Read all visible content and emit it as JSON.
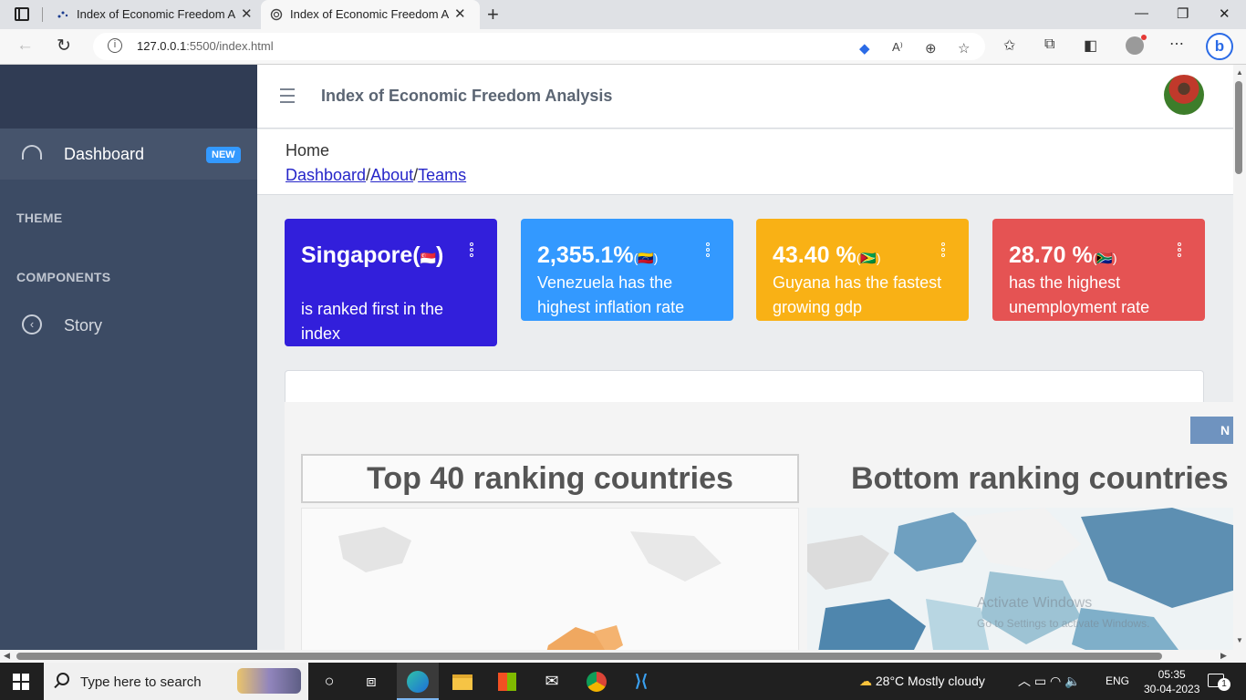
{
  "browser": {
    "tabs": [
      {
        "title": "Index of Economic Freedom Ana",
        "active": false
      },
      {
        "title": "Index of Economic Freedom Ana",
        "active": true
      }
    ],
    "url_host": "127.0.0.1",
    "url_path": ":5500/index.html"
  },
  "sidebar": {
    "items": [
      {
        "label": "Dashboard",
        "badge": "NEW",
        "icon": "speedometer-icon"
      },
      {
        "label": "Story",
        "icon": "chevron-circle-icon"
      }
    ],
    "sections": [
      "THEME",
      "COMPONENTS"
    ]
  },
  "header": {
    "title": "Index of Economic Freedom Analysis"
  },
  "breadcrumb": {
    "home": "Home",
    "links": [
      "Dashboard",
      "About",
      "Teams"
    ],
    "separator": "/"
  },
  "cards": [
    {
      "value": "Singapore(",
      "flag": "🇸🇬",
      "suffix": ")",
      "desc": "is ranked first in the index",
      "color": "#321fdb"
    },
    {
      "value": "2,355.1%",
      "flag": "(🇻🇪)",
      "suffix": "",
      "desc": "Venezuela has the highest inflation rate",
      "color": "#3399ff"
    },
    {
      "value": "43.40 %",
      "flag": "(🇬🇾)",
      "suffix": "",
      "desc": "Guyana has the fastest growing gdp",
      "color": "#f9b115"
    },
    {
      "value": "28.70 %",
      "flag": "(🇿🇦)",
      "suffix": "",
      "desc": "has the highest unemployment rate",
      "color": "#e55353"
    }
  ],
  "viz": {
    "button_label": "N",
    "title_left": "Top 40 ranking countries",
    "title_right": "Bottom ranking countries",
    "watermark_title": "Activate Windows",
    "watermark_sub": "Go to Settings to activate Windows."
  },
  "taskbar": {
    "search_placeholder": "Type here to search",
    "weather": "28°C  Mostly cloudy",
    "language": "ENG",
    "time": "05:35",
    "date": "30-04-2023",
    "notifications": "1"
  }
}
